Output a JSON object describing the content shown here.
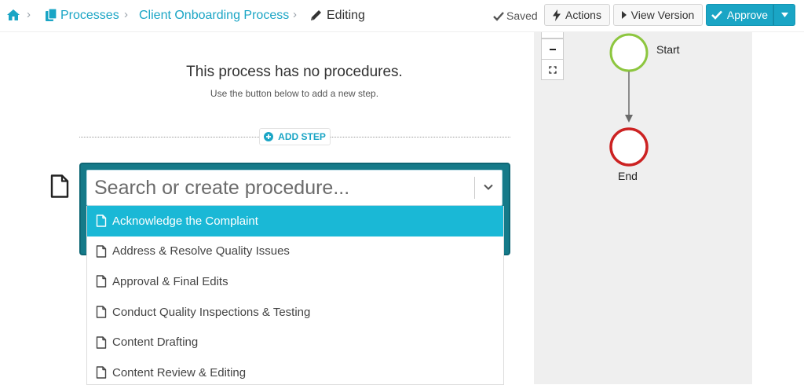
{
  "breadcrumb": {
    "items": [
      "Processes",
      "Client Onboarding Process"
    ],
    "current": "Editing",
    "separator": "›"
  },
  "header": {
    "status": "Saved",
    "actions_label": "Actions",
    "view_version_label": "View Version",
    "approve_label": "Approve"
  },
  "editor": {
    "empty_title": "This process has no procedures.",
    "empty_subtitle": "Use the button below to add a new step.",
    "add_step_label": "ADD STEP",
    "search": {
      "placeholder": "Search or create procedure...",
      "value": ""
    },
    "options": [
      "Acknowledge the Complaint",
      "Address & Resolve Quality Issues",
      "Approval & Final Edits",
      "Conduct Quality Inspections & Testing",
      "Content Drafting",
      "Content Review & Editing"
    ],
    "highlighted_option_index": 0
  },
  "diagram": {
    "start_label": "Start",
    "end_label": "End",
    "zoom_out_symbol": "−"
  },
  "colors": {
    "accent": "#1aa5c5",
    "highlight": "#1ab8d6",
    "card": "#157a89",
    "start_node": "#8dc63f",
    "end_node": "#cc2222",
    "panel_bg": "#efefef"
  },
  "icons": {
    "home": "home-icon",
    "processes": "copy-icon",
    "editing": "pencil-icon",
    "saved": "check-icon",
    "actions": "bolt-icon",
    "view_version": "caret-right-icon",
    "approve": "check-icon",
    "approve_menu": "caret-down-icon",
    "add_step": "plus-circle-icon",
    "procedure": "file-icon",
    "dropdown": "chevron-down-icon",
    "zoom_out": "minus-icon",
    "fit": "expand-icon"
  }
}
